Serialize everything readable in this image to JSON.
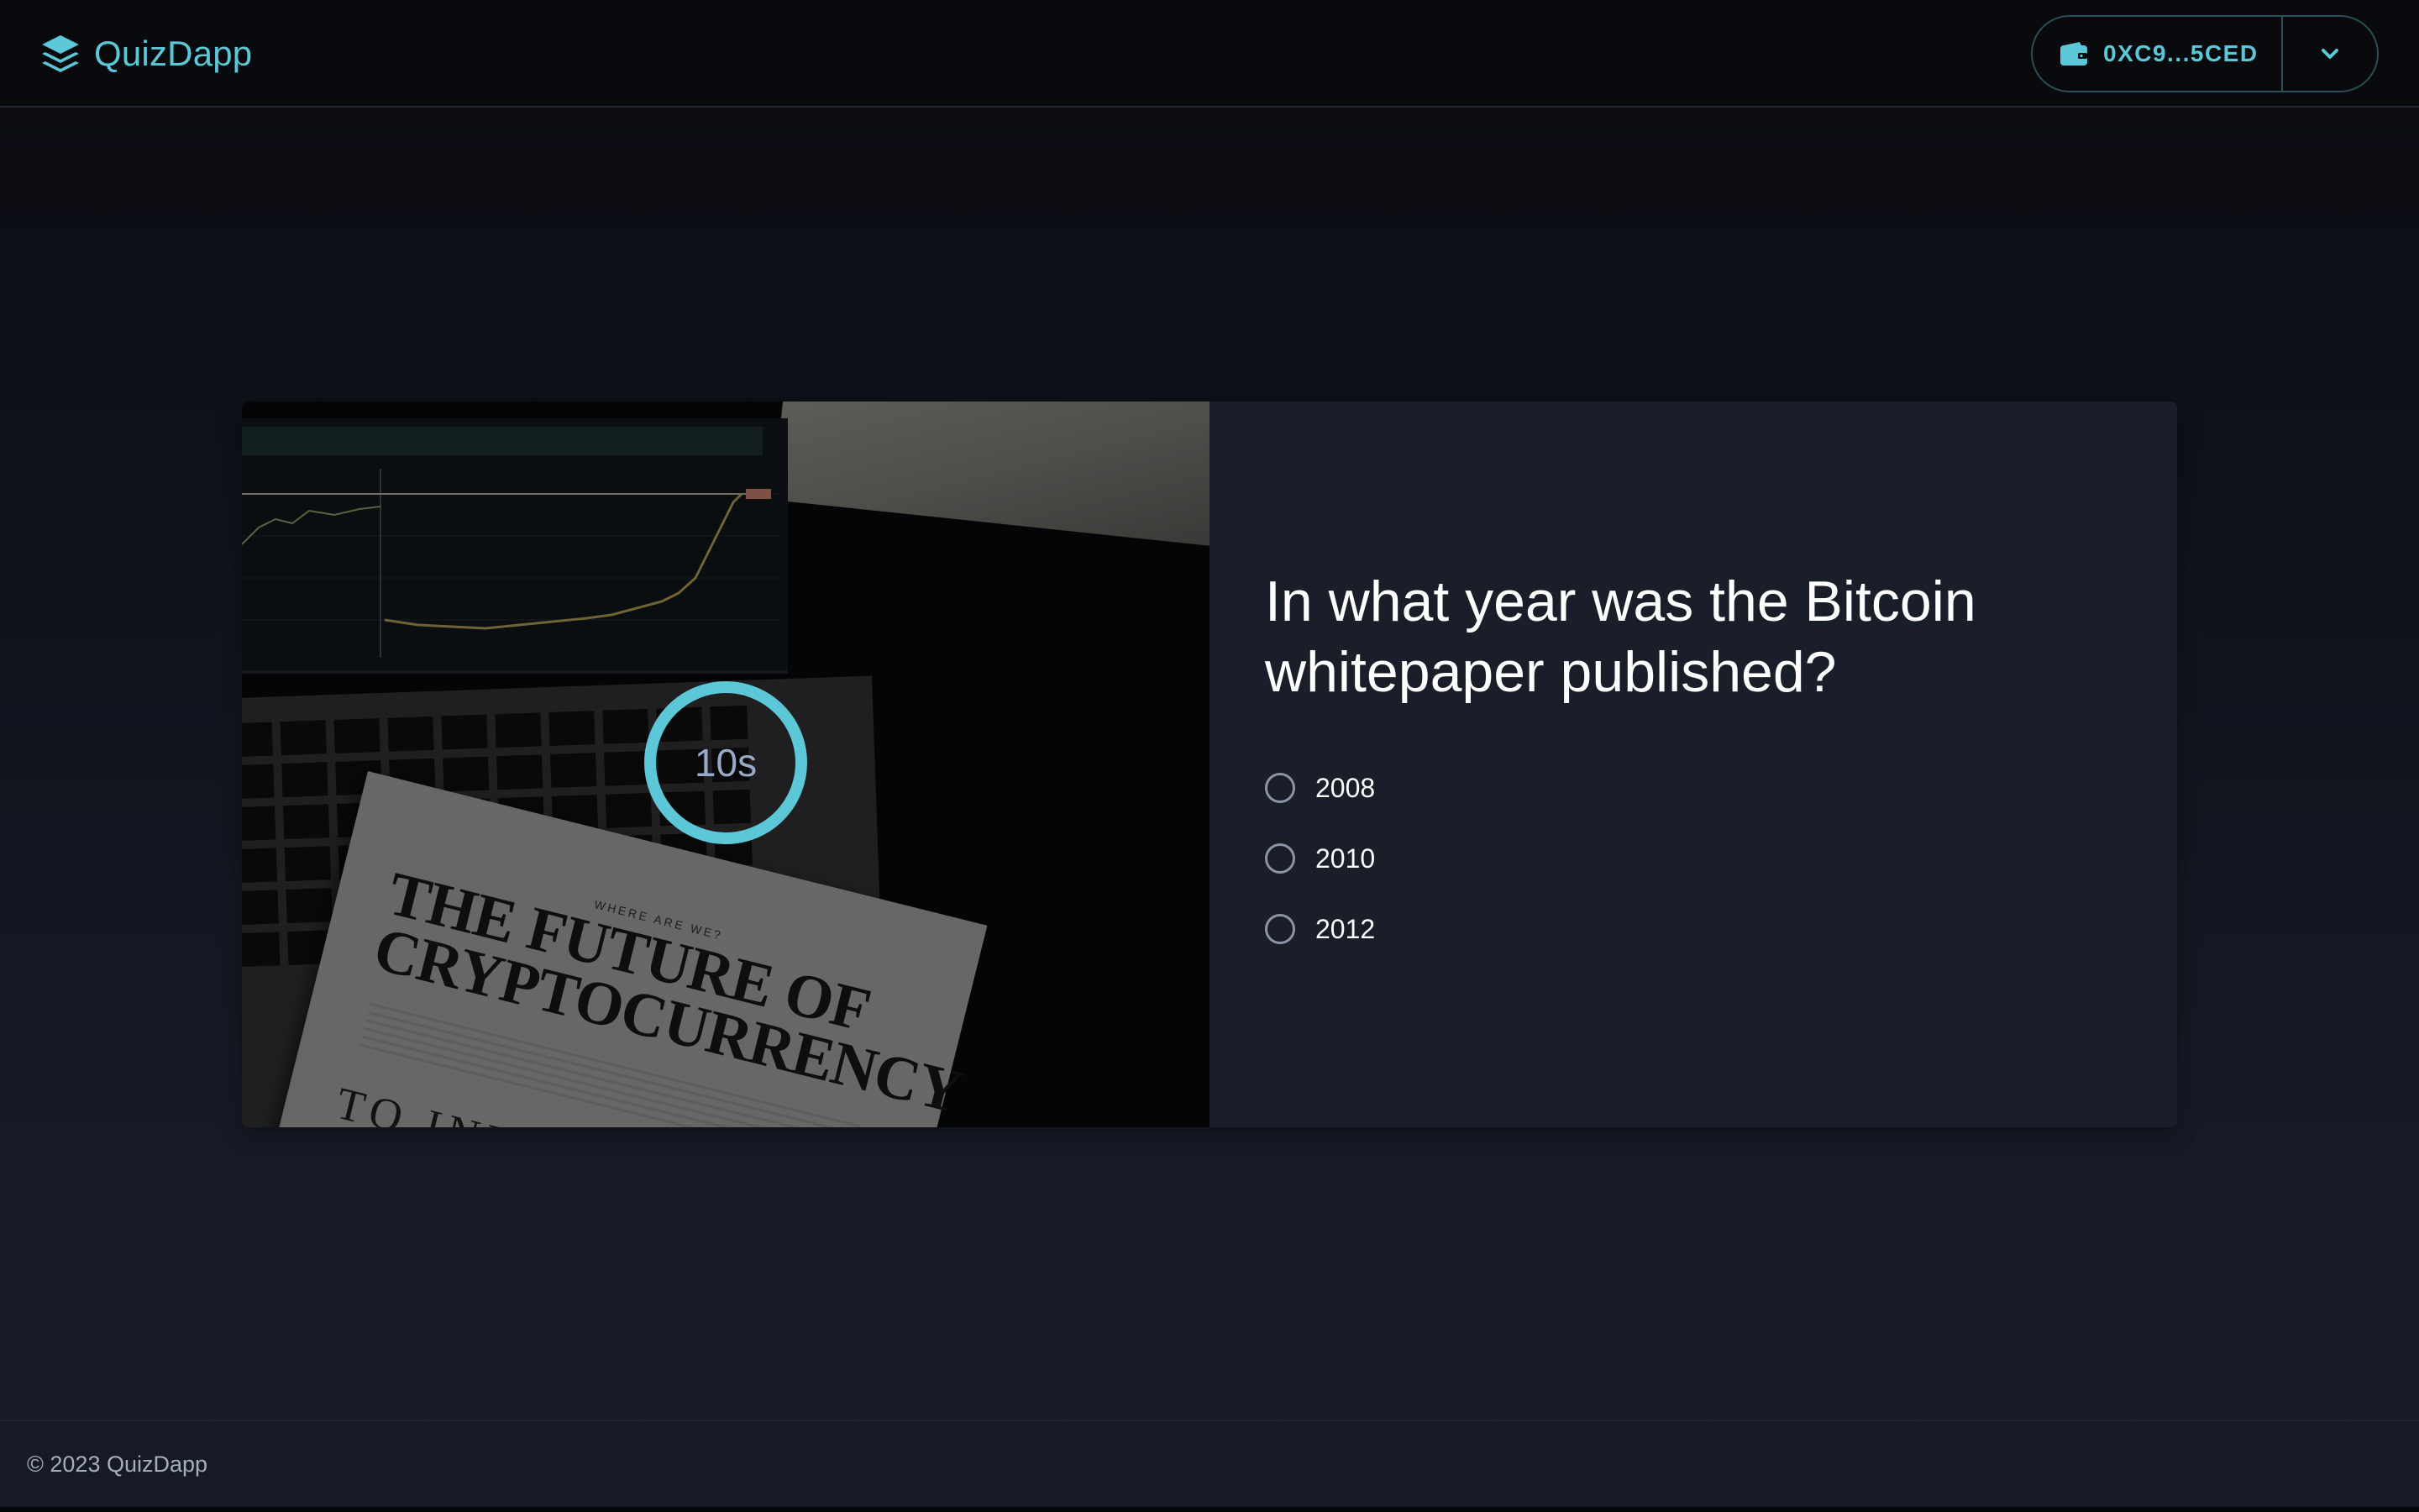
{
  "brand": {
    "name": "QuizDapp",
    "icon": "layers-icon",
    "color": "#5cc7d6"
  },
  "wallet": {
    "address": "0XC9...5CED",
    "icon": "wallet-icon",
    "toggle_icon": "chevron-down-icon"
  },
  "quiz": {
    "image": {
      "magazine_kicker": "WHERE ARE WE?",
      "magazine_title": "THE FUTURE OF CRYPTOCURRENCY",
      "magazine_subtitle": "TO INVEST OR"
    },
    "timer": {
      "text": "10s",
      "ring_color": "#5cc7d6"
    },
    "question": "In what year was the Bitcoin whitepaper published?",
    "options": [
      {
        "label": "2008"
      },
      {
        "label": "2010"
      },
      {
        "label": "2012"
      }
    ]
  },
  "footer": {
    "text": "© 2023 QuizDapp"
  },
  "colors": {
    "accent": "#5cc7d6",
    "background": "#0f121a",
    "card": "#1a1e29"
  }
}
